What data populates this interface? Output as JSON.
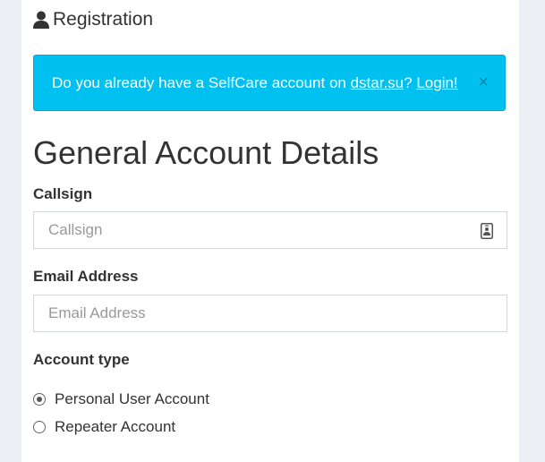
{
  "header": {
    "title": "Registration",
    "icon": "user-icon"
  },
  "alert": {
    "text_before": "Do you already have a SelfCare account on ",
    "link_site": "dstar.su",
    "text_between": "? ",
    "link_login": "Login!",
    "close_symbol": "×"
  },
  "section": {
    "title": "General Account Details"
  },
  "callsign": {
    "label": "Callsign",
    "placeholder": "Callsign",
    "icon": "id-card-icon"
  },
  "email": {
    "label": "Email Address",
    "placeholder": "Email Address"
  },
  "account_type": {
    "label": "Account type",
    "options": [
      {
        "label": "Personal User Account",
        "selected": true
      },
      {
        "label": "Repeater Account",
        "selected": false
      }
    ]
  }
}
